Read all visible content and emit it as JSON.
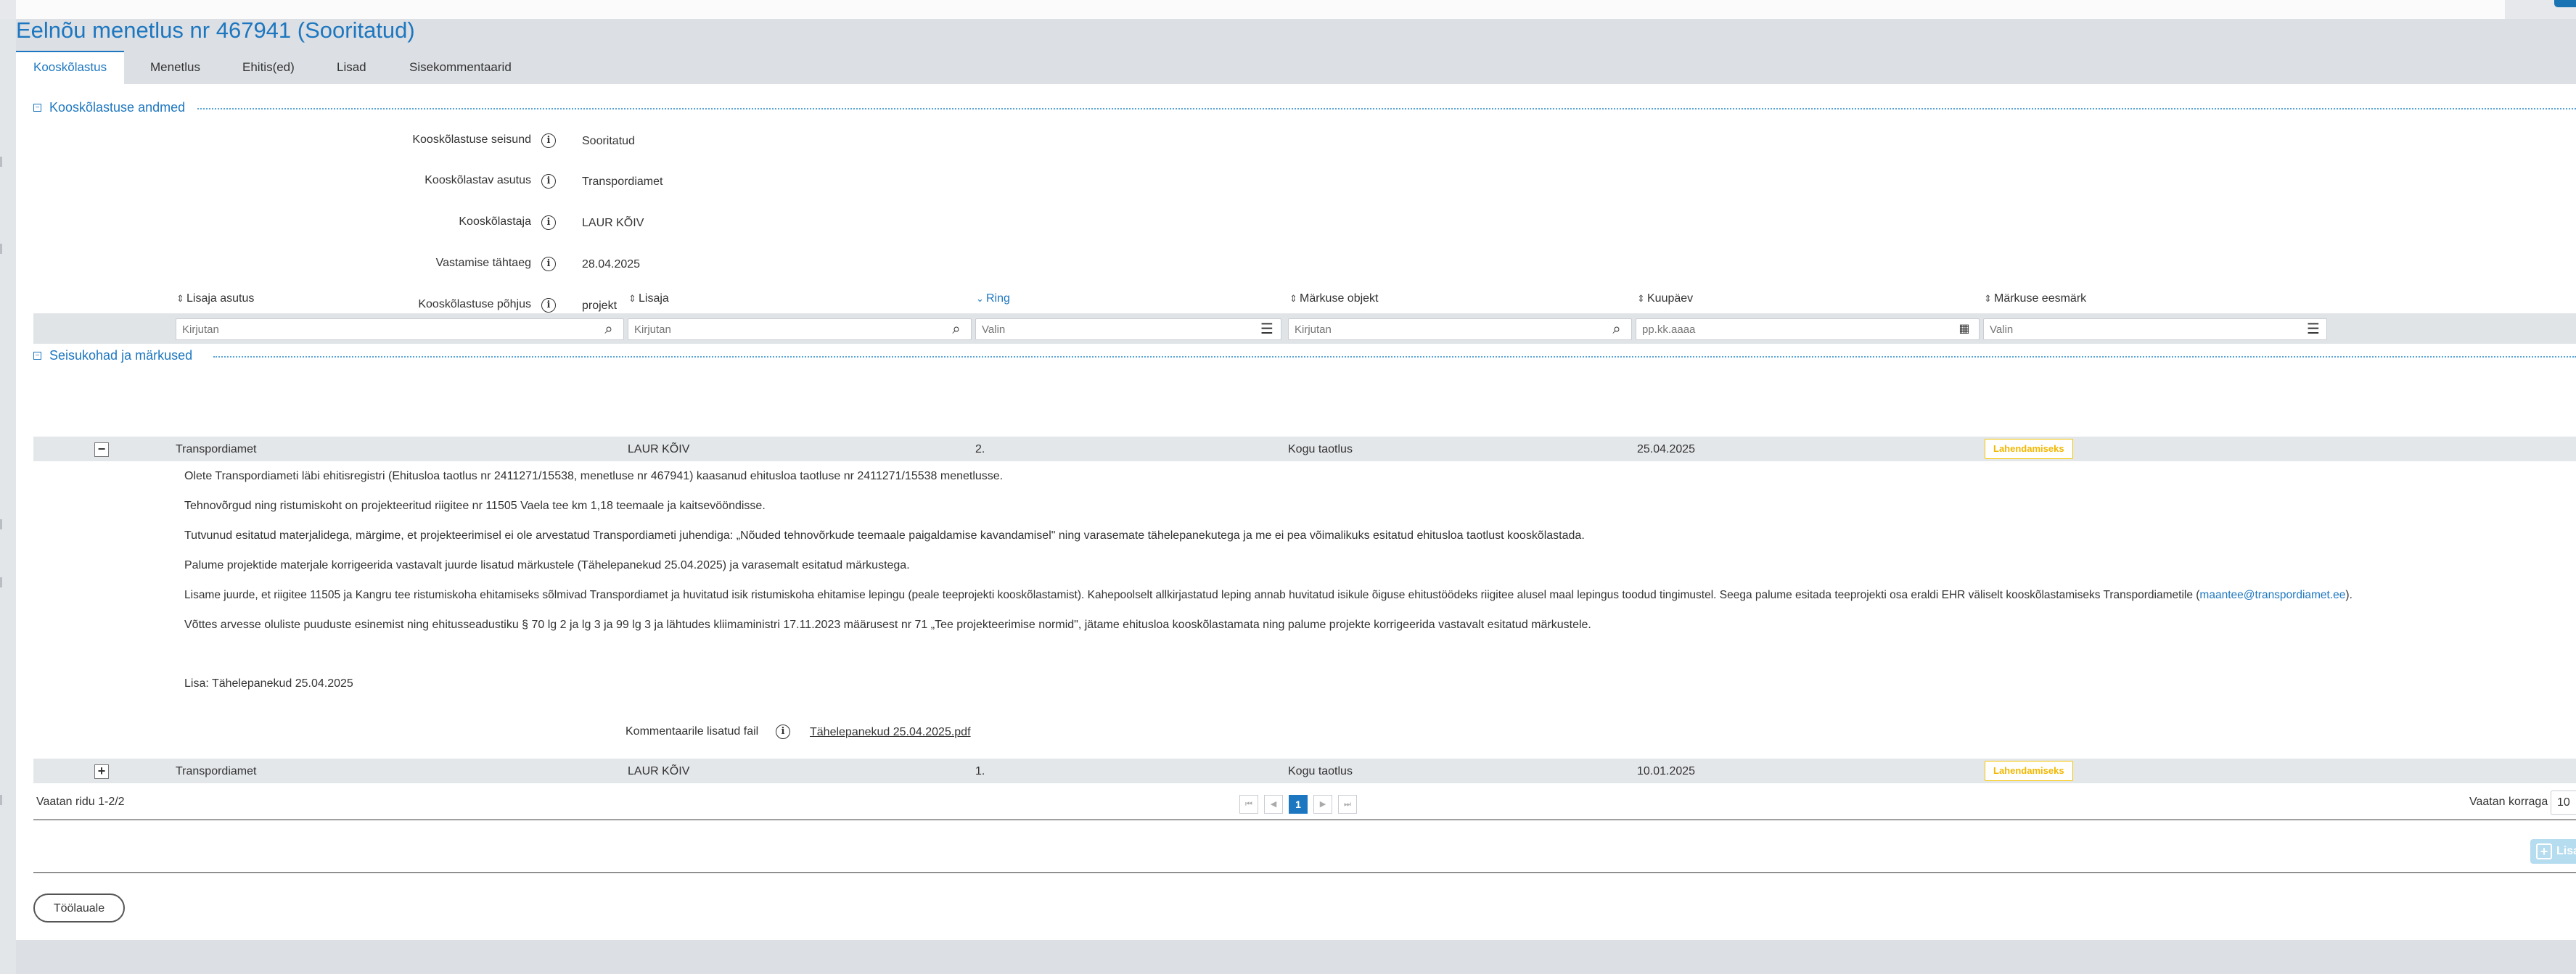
{
  "page": {
    "title": "Eelnõu menetlus nr 467941 (Sooritatud)"
  },
  "tabs": [
    {
      "label": "Kooskõlastus",
      "active": true
    },
    {
      "label": "Menetlus",
      "active": false
    },
    {
      "label": "Ehitis(ed)",
      "active": false
    },
    {
      "label": "Lisad",
      "active": false
    },
    {
      "label": "Sisekommentaarid",
      "active": false
    }
  ],
  "approval_section": {
    "title": "Kooskõlastuse andmed",
    "toggle": "−",
    "fields": [
      {
        "label": "Kooskõlastuse seisund",
        "value": "Sooritatud"
      },
      {
        "label": "Kooskõlastav asutus",
        "value": "Transpordiamet"
      },
      {
        "label": "Kooskõlastaja",
        "value": "LAUR KÕIV"
      },
      {
        "label": "Vastamise tähtaeg",
        "value": "28.04.2025"
      },
      {
        "label": "Kooskõlastuse põhjus",
        "value": "projekt"
      }
    ]
  },
  "remarks_section": {
    "title": "Seisukohad ja märkused",
    "toggle": "−",
    "columns": [
      {
        "label": "Lisaja asutus",
        "sorted": false
      },
      {
        "label": "Lisaja",
        "sorted": false
      },
      {
        "label": "Ring",
        "sorted": true
      },
      {
        "label": "Märkuse objekt",
        "sorted": false
      },
      {
        "label": "Kuupäev",
        "sorted": false
      },
      {
        "label": "Märkuse eesmärk",
        "sorted": false
      }
    ],
    "filters": [
      {
        "placeholder": "Kirjutan",
        "icon": "search-icon"
      },
      {
        "placeholder": "Kirjutan",
        "icon": "search-icon"
      },
      {
        "placeholder": "Valin",
        "icon": "list-icon"
      },
      {
        "placeholder": "Kirjutan",
        "icon": "search-icon"
      },
      {
        "placeholder": "pp.kk.aaaa",
        "icon": "calendar-icon"
      },
      {
        "placeholder": "Valin",
        "icon": "list-icon"
      }
    ],
    "rows": [
      {
        "expander": "−",
        "institution": "Transpordiamet",
        "author": "LAUR KÕIV",
        "round": "2.",
        "object": "Kogu taotlus",
        "date": "25.04.2025",
        "purpose": "Lahendamiseks"
      },
      {
        "expander": "+",
        "institution": "Transpordiamet",
        "author": "LAUR KÕIV",
        "round": "1.",
        "object": "Kogu taotlus",
        "date": "10.01.2025",
        "purpose": "Lahendamiseks"
      }
    ],
    "detail": {
      "paragraphs": [
        "Olete Transpordiameti läbi ehitisregistri (Ehitusloa taotlus nr 2411271/15538, menetluse nr 467941) kaasanud ehitusloa taotluse nr 2411271/15538 menetlusse.",
        "Tehnovõrgud ning ristumiskoht on projekteeritud riigitee nr 11505 Vaela tee km 1,18 teemaale ja kaitsevööndisse.",
        "Tutvunud esitatud materjalidega, märgime, et projekteerimisel ei ole arvestatud Transpordiameti juhendiga: „Nõuded tehnovõrkude teemaale paigaldamise kavandamisel\" ning varasemate tähelepanekutega ja me ei pea võimalikuks esitatud ehitusloa taotlust kooskõlastada.",
        "Palume projektide materjale korrigeerida vastavalt juurde lisatud märkustele (Tähelepanekud 25.04.2025) ja varasemalt esitatud märkustega.",
        "Võttes arvesse oluliste puuduste esinemist ning ehitusseadustiku § 70 lg 2 ja lg 3 ja 99 lg 3 ja lähtudes kliimaministri 17.11.2023 määrusest nr 71 „Tee projekteerimise normid\", jätame ehitusloa kooskõlastamata ning palume projekte korrigeerida vastavalt esitatud märkustele.",
        "Lisa: Tähelepanekud 25.04.2025"
      ],
      "contract_text": "Lisame juurde, et riigitee 11505 ja Kangru tee ristumiskoha ehitamiseks sõlmivad Transpordiamet ja huvitatud isik ristumiskoha ehitamise lepingu (peale teeprojekti kooskõlastamist). Kahepoolselt allkirjastatud leping annab huvitatud isikule õiguse ehitustöödeks riigitee alusel maal lepingus toodud tingimustel. Seega palume esitada teeprojekti osa eraldi EHR väliselt kooskõlastamiseks Transpordiametile (",
      "contract_email": "maantee@transpordiamet.ee",
      "contract_end": ").",
      "attachment_label": "Kommentaarile lisatud fail",
      "attachment_file": "Tähelepanekud 25.04.2025.pdf"
    },
    "footer": {
      "rows_info": "Vaatan ridu 1-2/2",
      "current_page": "1",
      "page_size_label": "Vaatan korraga",
      "page_size": "10",
      "add_label": "Lisa"
    }
  },
  "actions": {
    "back_label": "Töölauale"
  },
  "colors": {
    "accent": "#1d77c0",
    "badge": "#f5c400"
  }
}
